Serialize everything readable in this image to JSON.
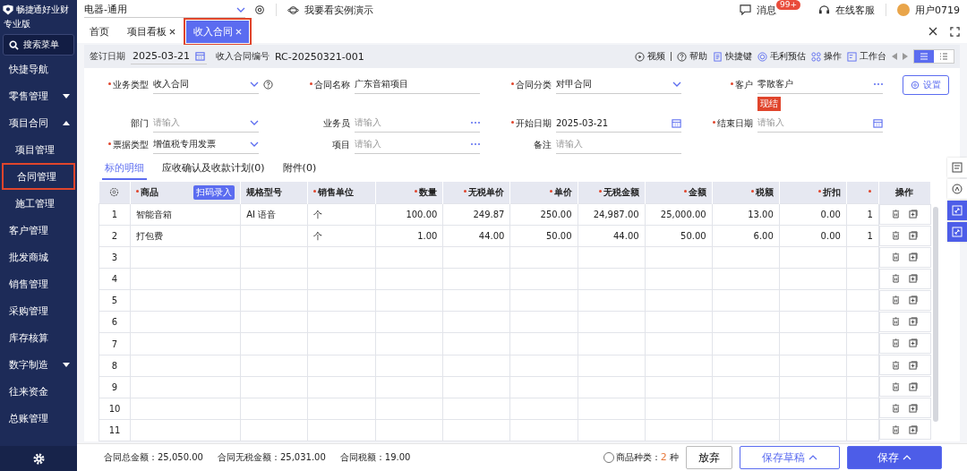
{
  "sidebar": {
    "brand": {
      "name": "畅捷通好业财",
      "edition": "专业版"
    },
    "search": {
      "placeholder": "搜索菜单"
    },
    "items": [
      {
        "label": "快捷导航"
      },
      {
        "label": "零售管理",
        "expanded": false
      },
      {
        "label": "项目合同",
        "expanded": true,
        "children": [
          {
            "label": "项目管理",
            "selected": false
          },
          {
            "label": "合同管理",
            "selected": true
          },
          {
            "label": "施工管理",
            "selected": false
          }
        ]
      },
      {
        "label": "客户管理"
      },
      {
        "label": "批发商城"
      },
      {
        "label": "销售管理"
      },
      {
        "label": "采购管理"
      },
      {
        "label": "库存核算"
      },
      {
        "label": "数字制造",
        "expanded": false
      },
      {
        "label": "往来资金"
      },
      {
        "label": "总账管理"
      }
    ]
  },
  "topbar": {
    "org": "电器-通用",
    "demo": "我要看实例演示",
    "messages": {
      "label": "消息",
      "badge": "99+"
    },
    "service": "在线客服",
    "user": "用户0719"
  },
  "tabs": [
    {
      "label": "首页",
      "closable": false,
      "selected": false
    },
    {
      "label": "项目看板",
      "closable": true,
      "selected": false
    },
    {
      "label": "收入合同",
      "closable": true,
      "selected": true
    }
  ],
  "header": {
    "sign_date": {
      "label": "签订日期",
      "value": "2025-03-21"
    },
    "number": {
      "label": "收入合同编号",
      "value": "RC-20250321-001"
    },
    "actions": [
      {
        "label": "视频",
        "kind": "play"
      },
      {
        "label": "帮助",
        "kind": "help"
      },
      {
        "label": "快捷键",
        "kind": "keys"
      },
      {
        "label": "毛利预估",
        "kind": "profit"
      },
      {
        "label": "操作",
        "kind": "grid"
      },
      {
        "label": "工作台",
        "kind": "desk"
      }
    ],
    "views": [
      {
        "kind": "list",
        "selected": true
      },
      {
        "kind": "detail",
        "selected": false
      }
    ]
  },
  "form": {
    "settings": "设置",
    "fields": [
      {
        "label": "业务类型",
        "required": true,
        "value": "收入合同",
        "kind": "select",
        "help": true
      },
      {
        "label": "合同名称",
        "required": true,
        "value": "广东音箱项目",
        "kind": "text"
      },
      {
        "label": "合同分类",
        "required": true,
        "value": "对甲合同",
        "kind": "select"
      },
      {
        "label": "客户",
        "required": true,
        "value": "零散客户",
        "kind": "lookup",
        "tag": "现结"
      },
      {
        "label": "部门",
        "required": false,
        "placeholder": "请输入",
        "kind": "select"
      },
      {
        "label": "业务员",
        "required": false,
        "placeholder": "请输入",
        "kind": "lookup"
      },
      {
        "label": "开始日期",
        "required": true,
        "value": "2025-03-21",
        "kind": "date"
      },
      {
        "label": "结束日期",
        "required": true,
        "placeholder": "请输入",
        "kind": "date"
      },
      {
        "label": "票据类型",
        "required": true,
        "value": "增值税专用发票",
        "kind": "select"
      },
      {
        "label": "项目",
        "required": false,
        "placeholder": "请输入",
        "kind": "lookup"
      },
      {
        "label": "备注",
        "required": false,
        "placeholder": "请输入",
        "kind": "text"
      }
    ]
  },
  "detail_tabs": [
    {
      "label": "标的明细",
      "selected": true
    },
    {
      "label": "应收确认及收款计划(0)",
      "selected": false
    },
    {
      "label": "附件(0)",
      "selected": false
    }
  ],
  "table": {
    "scan_button": "扫码录入",
    "columns": [
      {
        "label": "商品",
        "required": true
      },
      {
        "label": "规格型号",
        "required": false
      },
      {
        "label": "销售单位",
        "required": true
      },
      {
        "label": "数量",
        "required": true
      },
      {
        "label": "无税单价",
        "required": true
      },
      {
        "label": "单价",
        "required": true
      },
      {
        "label": "无税金额",
        "required": true
      },
      {
        "label": "金额",
        "required": true
      },
      {
        "label": "税额",
        "required": true
      },
      {
        "label": "折扣",
        "required": true
      },
      {
        "required": true
      }
    ],
    "action_column": "操作",
    "rows": [
      {
        "no": "1",
        "cells": [
          "智能音箱",
          "AI 语音",
          "个",
          "100.00",
          "249.87",
          "250.00",
          "24,987.00",
          "25,000.00",
          "13.00",
          "0.00",
          "1"
        ]
      },
      {
        "no": "2",
        "cells": [
          "打包费",
          "",
          "个",
          "1.00",
          "44.00",
          "50.00",
          "44.00",
          "50.00",
          "6.00",
          "0.00",
          "1"
        ]
      },
      {
        "no": "3"
      },
      {
        "no": "4"
      },
      {
        "no": "5"
      },
      {
        "no": "6"
      },
      {
        "no": "7"
      },
      {
        "no": "8"
      },
      {
        "no": "9"
      },
      {
        "no": "10"
      },
      {
        "no": "11"
      }
    ]
  },
  "footer": {
    "totals": [
      {
        "label": "合同总金额：",
        "value": "25,050.00"
      },
      {
        "label": "合同无税金额：",
        "value": "25,031.00"
      },
      {
        "label": "合同税额：",
        "value": "19.00"
      }
    ],
    "item_kinds": {
      "label": "商品种类：",
      "count": "2",
      "unit": "种"
    },
    "buttons": [
      {
        "label": "放弃",
        "kind": "plain"
      },
      {
        "label": "保存草稿",
        "kind": "outline"
      },
      {
        "label": "保存",
        "kind": "primary"
      }
    ]
  }
}
